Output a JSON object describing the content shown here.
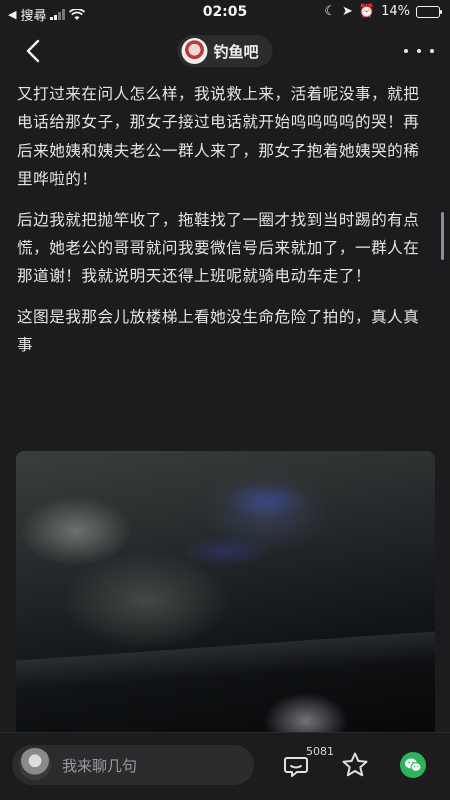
{
  "status_bar": {
    "carrier": "搜尋",
    "time": "02:05",
    "battery_percent": "14%",
    "battery_level": 0.14
  },
  "nav": {
    "forum_name": "钓鱼吧"
  },
  "post": {
    "paragraphs": [
      "又打过来在问人怎么样，我说救上来，活着呢没事，就把电话给那女子，那女子接过电话就开始呜呜呜呜的哭！再后来她姨和姨夫老公一群人来了，那女子抱着她姨哭的稀里哗啦的！",
      "后边我就把抛竿收了，拖鞋找了一圈才找到当时踢的有点慌，她老公的哥哥就问我要微信号后来就加了，一群人在那道谢！我就说明天还得上班呢就骑电动车走了！",
      "这图是我那会儿放楼梯上看她没生命危险了拍的，真人真事"
    ]
  },
  "bottom_bar": {
    "reply_placeholder": "我来聊几句",
    "comment_count": "5081"
  },
  "icons": {
    "back": "chevron-left-icon",
    "more": "more-dots-icon",
    "comment": "comment-icon",
    "favorite": "star-icon",
    "share": "wechat-icon"
  },
  "colors": {
    "background": "#1c1c1e",
    "wechat_green": "#2fb35a"
  }
}
